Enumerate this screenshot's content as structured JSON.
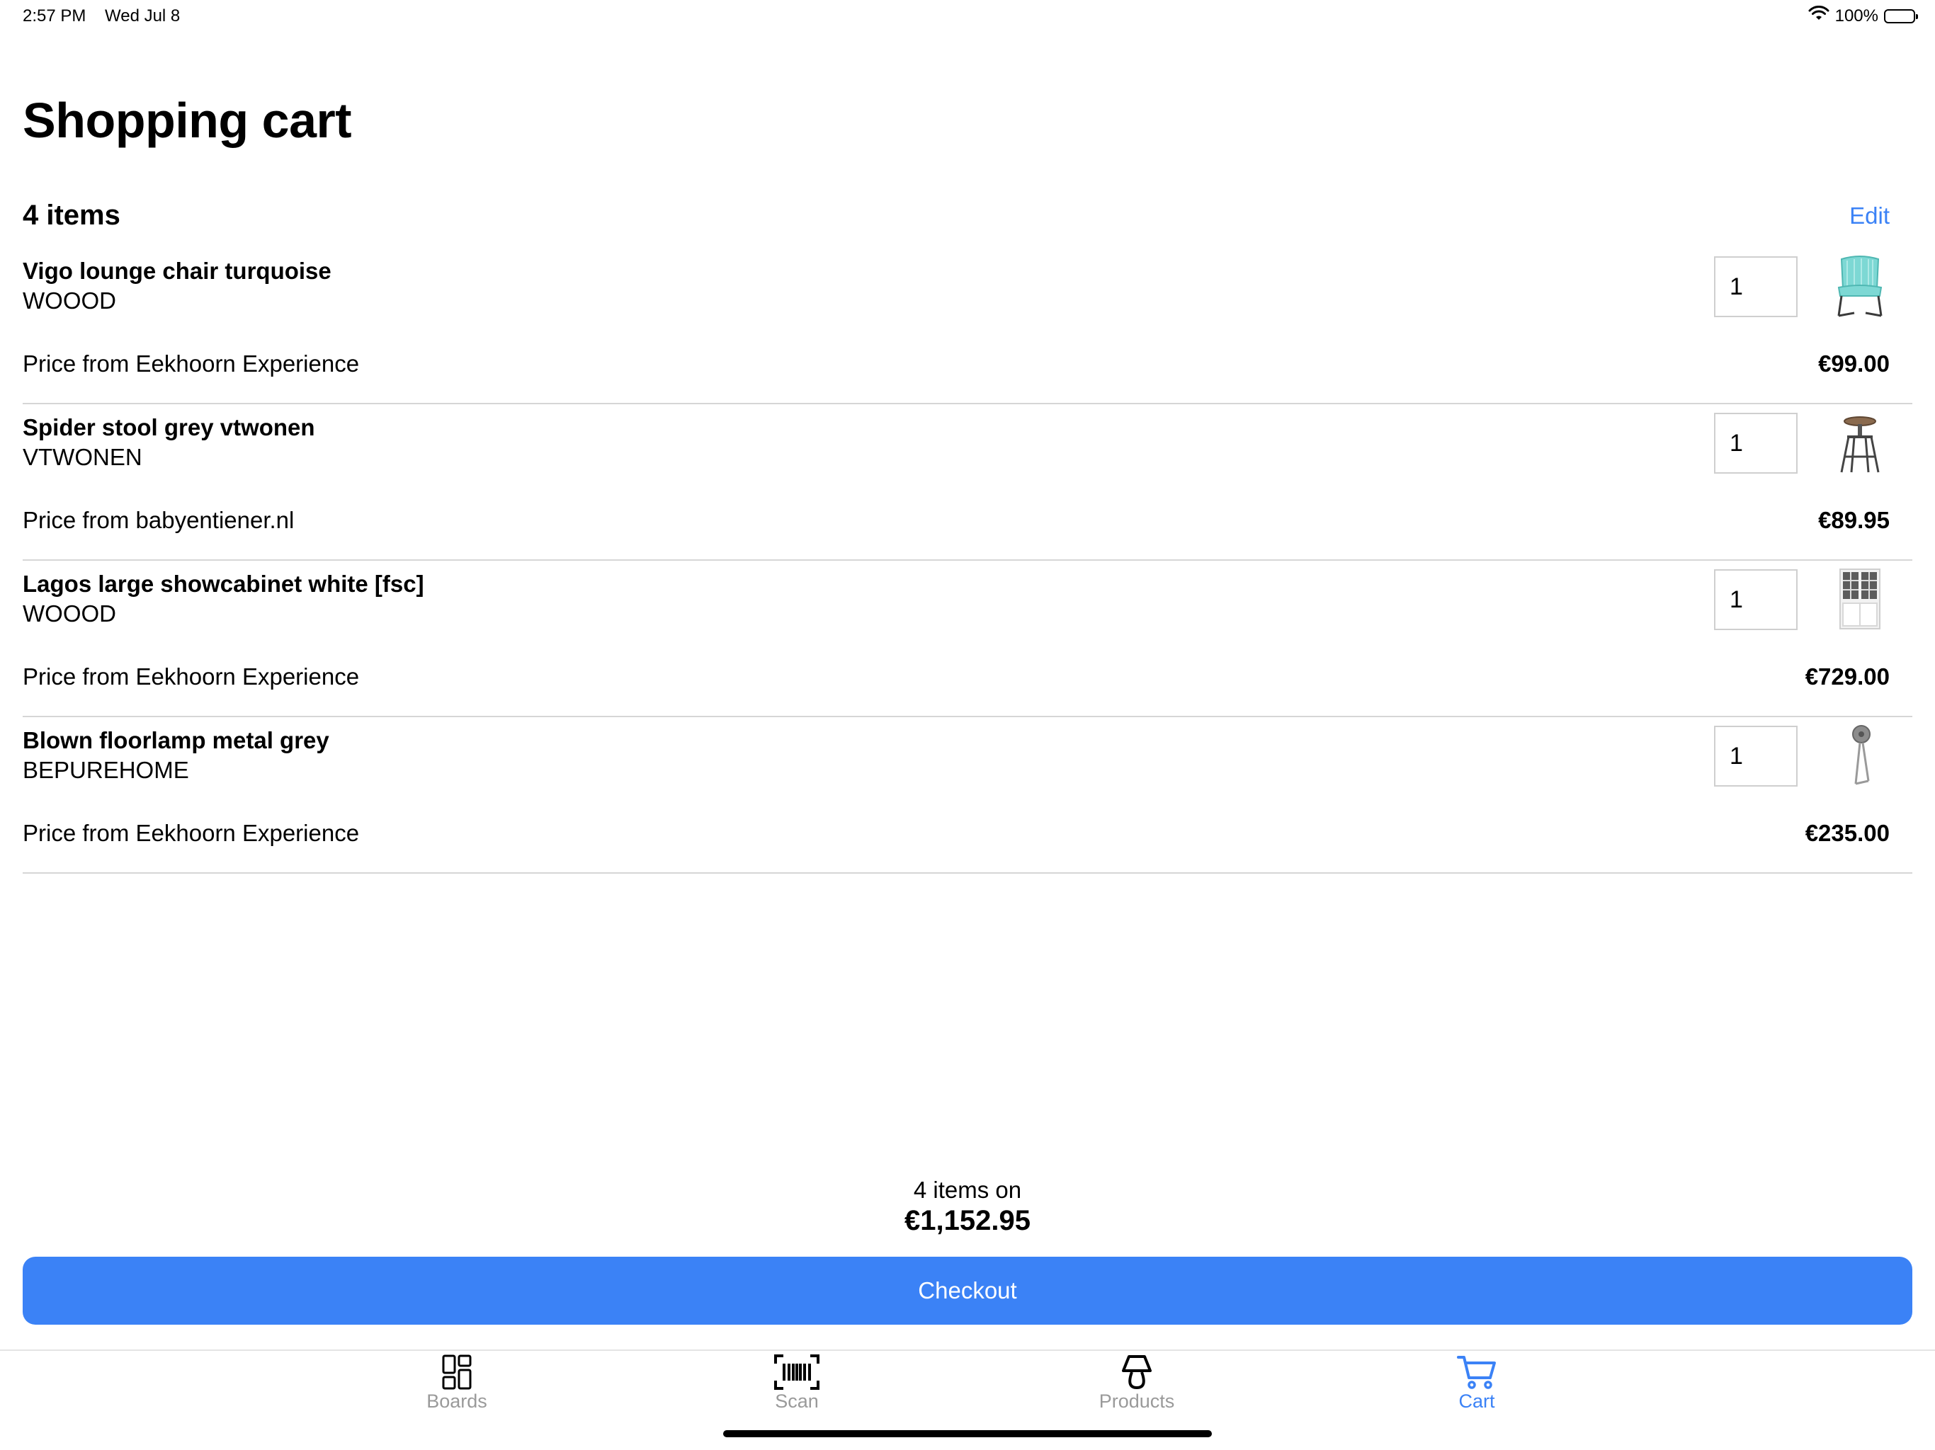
{
  "status_bar": {
    "time": "2:57 PM",
    "date": "Wed Jul 8",
    "battery": "100%",
    "icons": [
      "wifi-icon",
      "battery-icon"
    ]
  },
  "page": {
    "title": "Shopping cart",
    "items_count": "4 items",
    "edit_label": "Edit"
  },
  "cart": {
    "items": [
      {
        "name": "Vigo lounge chair turquoise",
        "brand": "WOOOD",
        "price_source": "Price from Eekhoorn Experience",
        "price": "€99.00",
        "quantity": "1",
        "thumbnail_icon": "lounge-chair-image"
      },
      {
        "name": "Spider stool grey vtwonen",
        "brand": "VTWONEN",
        "price_source": "Price from babyentiener.nl",
        "price": "€89.95",
        "quantity": "1",
        "thumbnail_icon": "stool-image"
      },
      {
        "name": "Lagos large showcabinet white [fsc]",
        "brand": "WOOOD",
        "price_source": "Price from Eekhoorn Experience",
        "price": "€729.00",
        "quantity": "1",
        "thumbnail_icon": "showcabinet-image"
      },
      {
        "name": "Blown floorlamp metal grey",
        "brand": "BEPUREHOME",
        "price_source": "Price from Eekhoorn Experience",
        "price": "€235.00",
        "quantity": "1",
        "thumbnail_icon": "floorlamp-image"
      }
    ]
  },
  "summary": {
    "count_text": "4 items on",
    "total": "€1,152.95",
    "checkout_label": "Checkout"
  },
  "tab_bar": {
    "tabs": [
      {
        "label": "Boards",
        "icon": "boards-icon",
        "active": false
      },
      {
        "label": "Scan",
        "icon": "barcode-icon",
        "active": false
      },
      {
        "label": "Products",
        "icon": "lamp-icon",
        "active": false
      },
      {
        "label": "Cart",
        "icon": "cart-icon",
        "active": true
      }
    ]
  },
  "colors": {
    "accent": "#3b82f6",
    "divider": "#d6d6d6",
    "inactive_tab": "#9a9a9a",
    "chair_turquoise": "#7dd8d4"
  }
}
